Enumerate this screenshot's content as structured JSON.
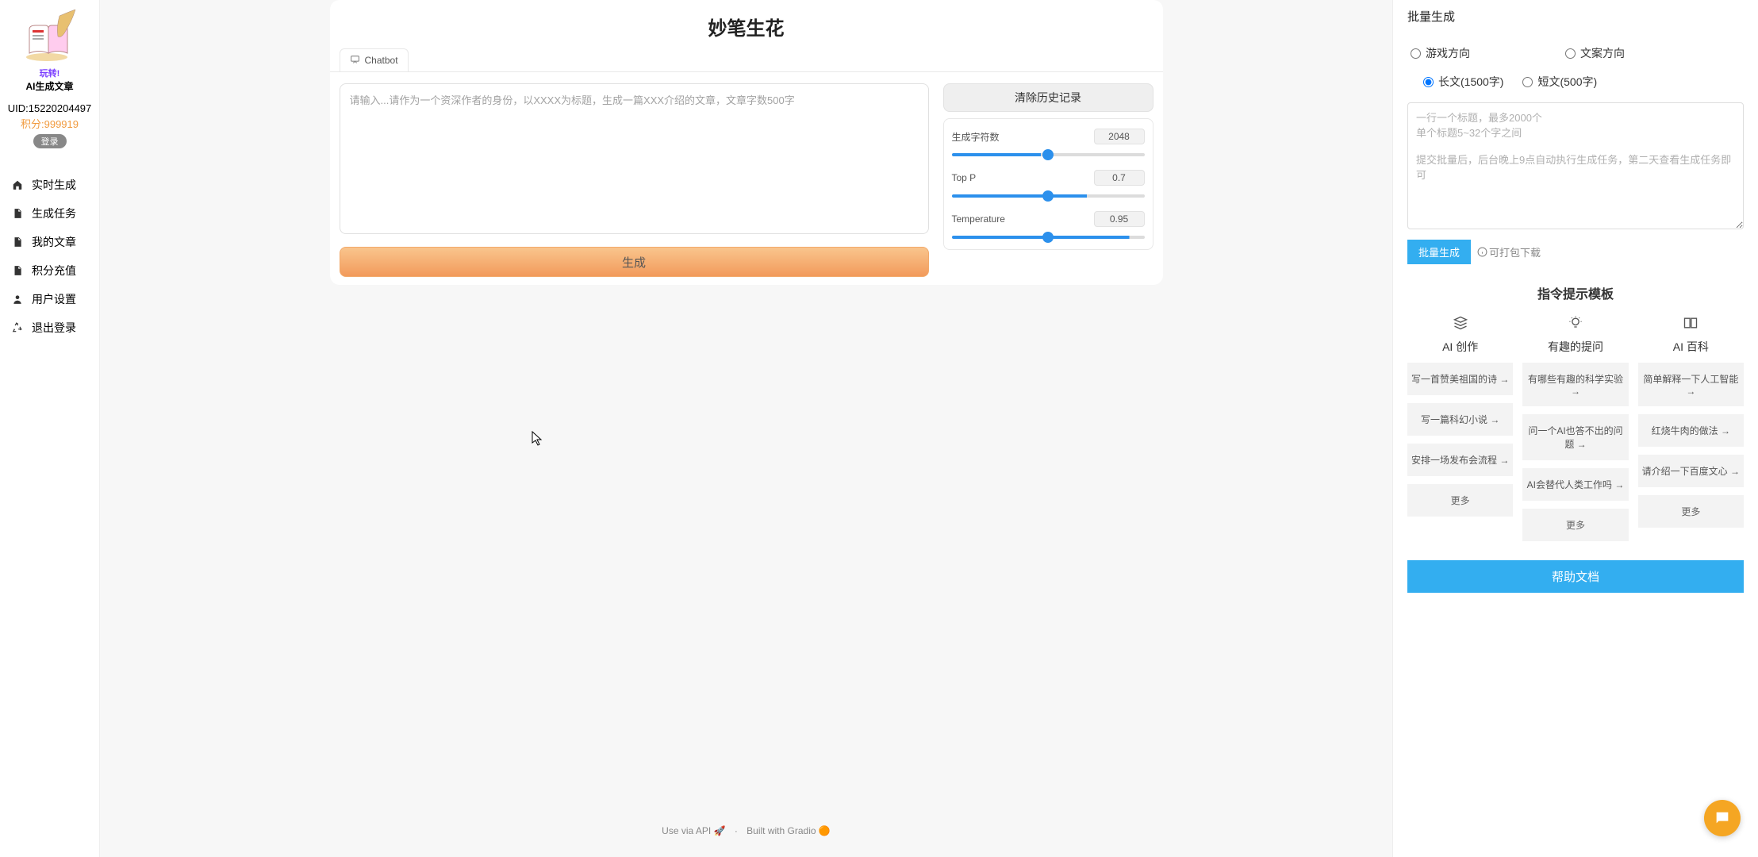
{
  "sidebar": {
    "brand_line1": "玩转!",
    "brand_line2": "AI生成文章",
    "uid_label": "UID:15220204497",
    "points_label": "积分:999919",
    "login_label": "登录",
    "nav": [
      {
        "icon": "home",
        "label": "实时生成"
      },
      {
        "icon": "file",
        "label": "生成任务"
      },
      {
        "icon": "file",
        "label": "我的文章"
      },
      {
        "icon": "file",
        "label": "积分充值"
      },
      {
        "icon": "user",
        "label": "用户设置"
      },
      {
        "icon": "recycle",
        "label": "退出登录"
      }
    ]
  },
  "center": {
    "title": "妙笔生花",
    "tab_label": "Chatbot",
    "prompt_placeholder": "请输入...请作为一个资深作者的身份，以XXXX为标题，生成一篇XXX介绍的文章，文章字数500字",
    "generate_label": "生成",
    "clear_history": "清除历史记录",
    "sliders": {
      "char_count": {
        "label": "生成字符数",
        "value": "2048",
        "pct": "46%"
      },
      "top_p": {
        "label": "Top P",
        "value": "0.7",
        "pct": "70%"
      },
      "temperature": {
        "label": "Temperature",
        "value": "0.95",
        "pct": "92%"
      }
    },
    "footer_api": "Use via API",
    "footer_built": "Built with Gradio"
  },
  "right": {
    "batch_title": "批量生成",
    "dir_game": "游戏方向",
    "dir_copy": "文案方向",
    "len_long": "长文(1500字)",
    "len_short": "短文(500字)",
    "batch_placeholder": "一行一个标题，最多2000个\n单个标题5~32个字之间\n\n提交批量后，后台晚上9点自动执行生成任务，第二天查看生成任务即可",
    "batch_btn": "批量生成",
    "pack_hint": "可打包下载",
    "template_title": "指令提示模板",
    "columns": [
      {
        "icon": "stack",
        "head": "AI 创作",
        "items": [
          "写一首赞美祖国的诗 →",
          "写一篇科幻小说 →",
          "安排一场发布会流程 →",
          "更多"
        ]
      },
      {
        "icon": "bulb",
        "head": "有趣的提问",
        "items": [
          "有哪些有趣的科学实验 →",
          "问一个AI也答不出的问题 →",
          "AI会替代人类工作吗 →",
          "更多"
        ]
      },
      {
        "icon": "book",
        "head": "AI 百科",
        "items": [
          "简单解释一下人工智能 →",
          "红烧牛肉的做法 →",
          "请介绍一下百度文心 →",
          "更多"
        ]
      }
    ],
    "help_doc": "帮助文档"
  }
}
